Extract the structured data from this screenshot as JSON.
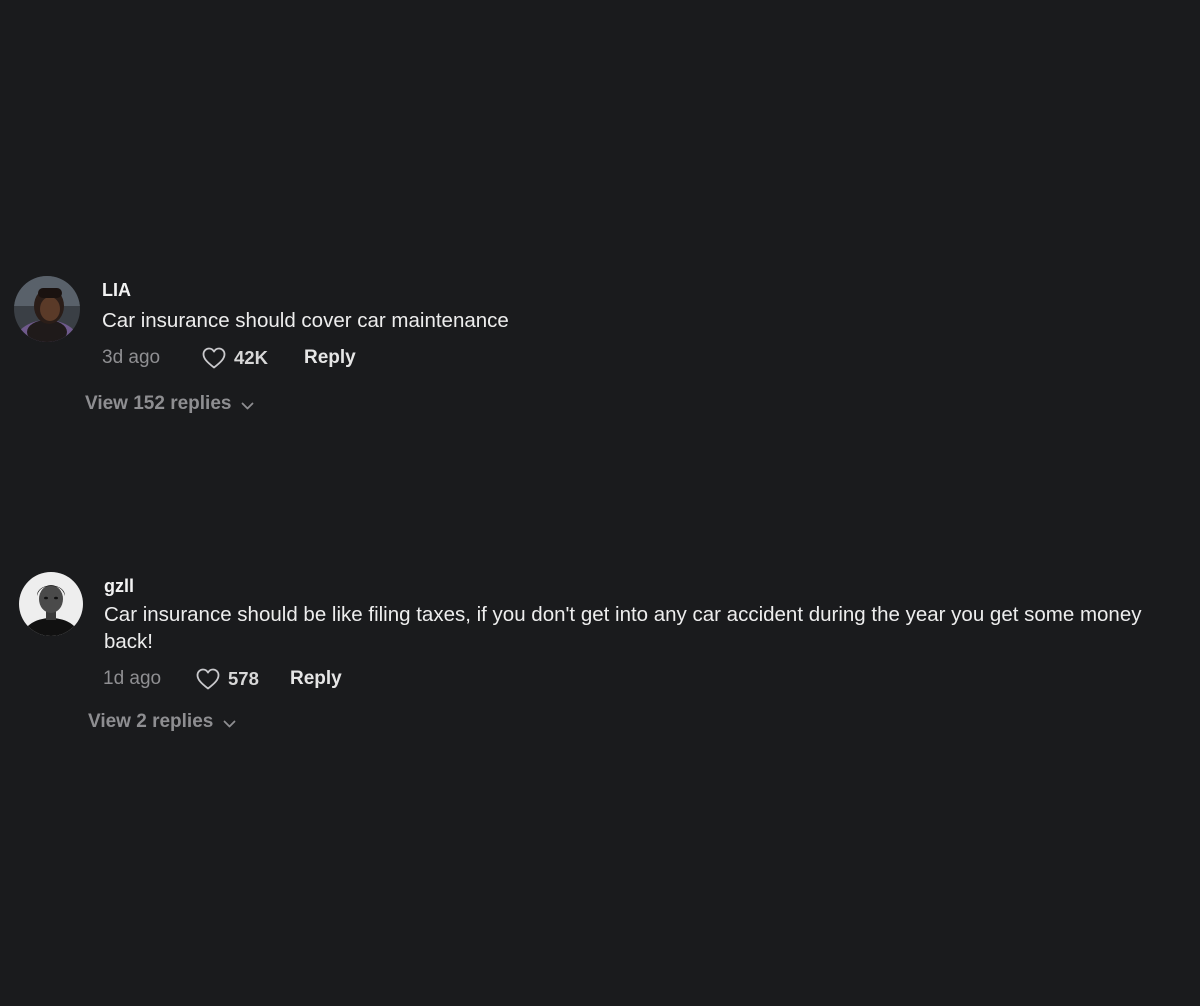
{
  "comments": [
    {
      "username": "LIA",
      "text": "Car insurance should cover car maintenance",
      "timestamp": "3d ago",
      "likes": "42K",
      "reply_label": "Reply",
      "view_replies": "View 152 replies"
    },
    {
      "username": "gzll",
      "text": "Car insurance should be like filing taxes, if you don't get into any car accident during the year you get some money back!",
      "timestamp": "1d ago",
      "likes": "578",
      "reply_label": "Reply",
      "view_replies": "View 2 replies"
    }
  ],
  "icons": {
    "like": "heart-outline-icon",
    "expand": "chevron-down-icon"
  },
  "colors": {
    "background": "#1a1b1d",
    "text_primary": "#ededed",
    "text_secondary": "#8f8f92"
  }
}
